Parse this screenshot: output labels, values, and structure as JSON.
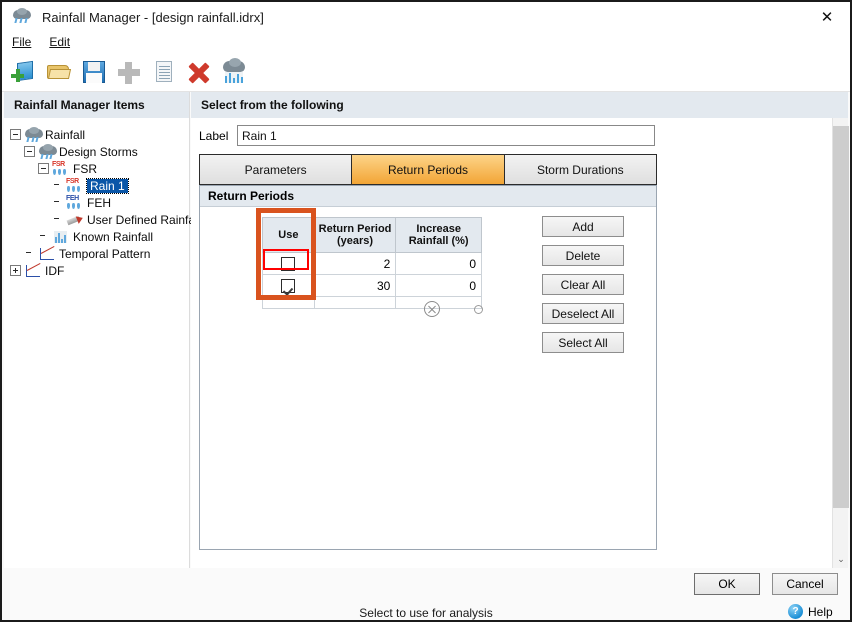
{
  "window": {
    "title": "Rainfall Manager - [design rainfall.idrx]",
    "title_icon": "rain-cloud-icon",
    "close_label": "✕"
  },
  "menu": {
    "items": [
      {
        "label": "File",
        "accel": "F"
      },
      {
        "label": "Edit",
        "accel": "E"
      }
    ]
  },
  "toolbar": {
    "buttons": [
      {
        "name": "new-icon"
      },
      {
        "name": "open-folder-icon"
      },
      {
        "name": "save-icon"
      },
      {
        "name": "add-icon"
      },
      {
        "name": "copy-icon"
      },
      {
        "name": "delete-icon"
      },
      {
        "name": "rainfall-icon"
      }
    ]
  },
  "sidebar": {
    "header": "Rainfall Manager Items",
    "tree": [
      {
        "label": "Rainfall",
        "depth": 0,
        "expander": "minus",
        "icon": "rain-cloud-icon",
        "selected": false
      },
      {
        "label": "Design Storms",
        "depth": 1,
        "expander": "minus",
        "icon": "rain-cloud-icon",
        "selected": false
      },
      {
        "label": "FSR",
        "depth": 2,
        "expander": "minus",
        "icon": "fsr-icon",
        "selected": false
      },
      {
        "label": "Rain 1",
        "depth": 3,
        "expander": "none",
        "icon": "fsr-icon",
        "selected": true
      },
      {
        "label": "FEH",
        "depth": 2,
        "expander": "none",
        "icon": "feh-icon",
        "selected": false
      },
      {
        "label": "User Defined Rainfall",
        "depth": 2,
        "expander": "none",
        "icon": "pencil-icon",
        "selected": false
      },
      {
        "label": "Known Rainfall",
        "depth": 1,
        "expander": "none",
        "icon": "bar-chart-icon",
        "selected": false
      },
      {
        "label": "Temporal Pattern",
        "depth": 0,
        "expander": "none",
        "icon": "line-graph-icon",
        "selected": false
      },
      {
        "label": "IDF",
        "depth": 0,
        "expander": "plus",
        "icon": "line-graph-icon",
        "selected": false
      }
    ]
  },
  "content": {
    "header": "Select from the following",
    "label_caption": "Label",
    "label_value": "Rain 1",
    "label_placeholder": "",
    "tabs": [
      {
        "label": "Parameters",
        "active": false
      },
      {
        "label": "Return Periods",
        "active": true
      },
      {
        "label": "Storm Durations",
        "active": false
      }
    ],
    "panel_title": "Return Periods",
    "grid": {
      "columns": [
        "Use",
        "Return Period (years)",
        "Increase Rainfall (%)"
      ],
      "column_lines": [
        [
          "Use"
        ],
        [
          "Return Period",
          "(years)"
        ],
        [
          "Increase",
          "Rainfall (%)"
        ]
      ],
      "rows": [
        {
          "use": false,
          "return_period": "2",
          "increase_rainfall": "0"
        },
        {
          "use": true,
          "return_period": "30",
          "increase_rainfall": "0"
        }
      ]
    },
    "indicators": [
      {
        "name": "circle-x-icon"
      },
      {
        "name": "circle-small-icon"
      }
    ],
    "actions": [
      {
        "label": "Add"
      },
      {
        "label": "Delete"
      },
      {
        "label": "Clear All"
      },
      {
        "label": "Deselect All"
      },
      {
        "label": "Select All"
      }
    ],
    "annotations": [
      {
        "name": "use-column-highlight",
        "color": "#d9531e"
      },
      {
        "name": "first-checkbox-highlight",
        "color": "#ff0000"
      }
    ]
  },
  "footer": {
    "ok_label": "OK",
    "cancel_label": "Cancel",
    "help_label": "Help",
    "help_glyph": "?",
    "status_text": "Select to use for analysis"
  },
  "scrollbar": {
    "down_arrow": "⌄"
  },
  "colors": {
    "accent_tab": "#f2a536",
    "selection": "#0a56a8",
    "header_bg": "#e3e9ef",
    "annotation_outer": "#d9531e",
    "annotation_inner": "#ff0000"
  }
}
